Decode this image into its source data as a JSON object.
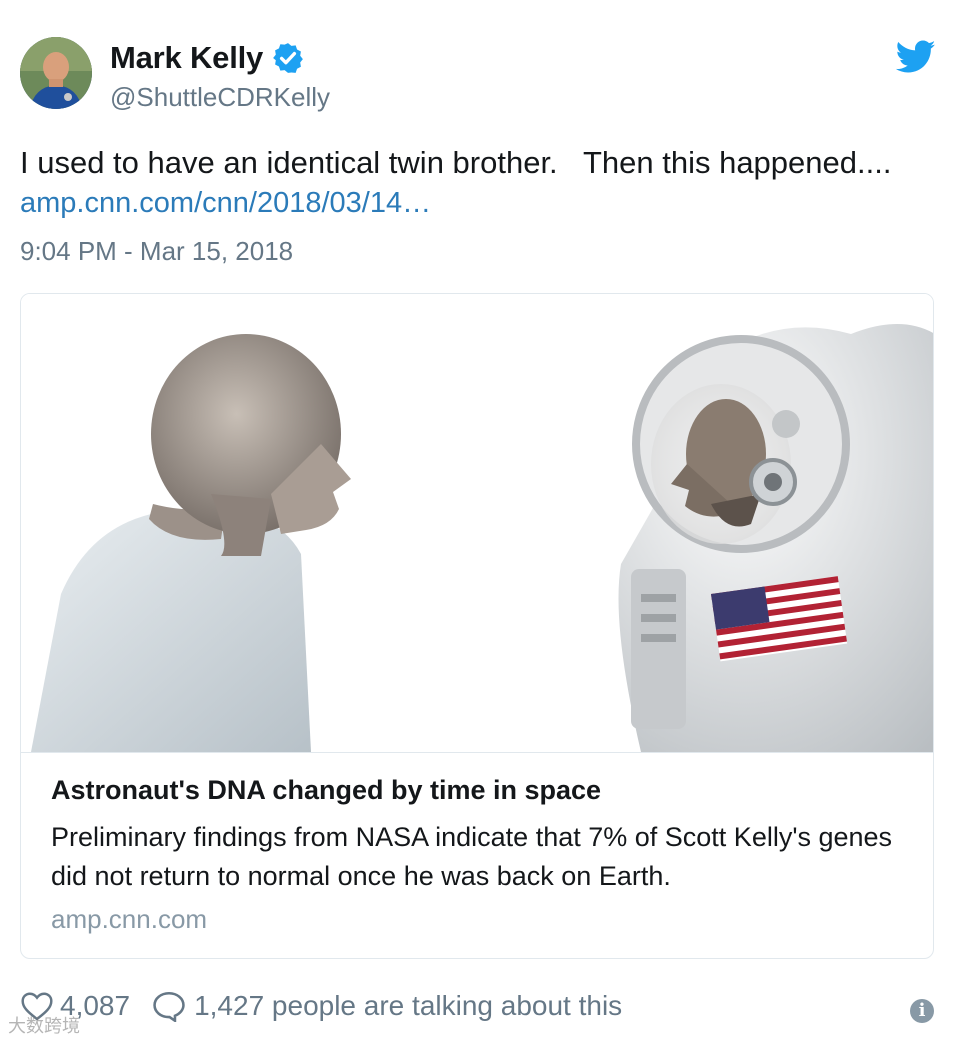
{
  "header": {
    "name": "Mark Kelly",
    "handle": "@ShuttleCDRKelly",
    "verified": true,
    "brand_color": "#1da1f2"
  },
  "tweet": {
    "text": "I used to have an identical twin brother.   Then this happened....",
    "link_text": "amp.cnn.com/cnn/2018/03/14…",
    "timestamp": "9:04 PM - Mar 15, 2018",
    "link_color": "#2b7bb9"
  },
  "card": {
    "title": "Astronaut's DNA changed by time in space",
    "description": "Preliminary findings from NASA indicate that 7% of Scott Kelly's genes did not return to normal once he was back on Earth.",
    "domain": "amp.cnn.com"
  },
  "actions": {
    "likes": "4,087",
    "talking": "1,427 people are talking about this"
  },
  "watermark": "大数跨境",
  "icons": [
    "verified-badge-icon",
    "twitter-bird-icon",
    "heart-icon",
    "reply-bubble-icon",
    "info-icon"
  ]
}
